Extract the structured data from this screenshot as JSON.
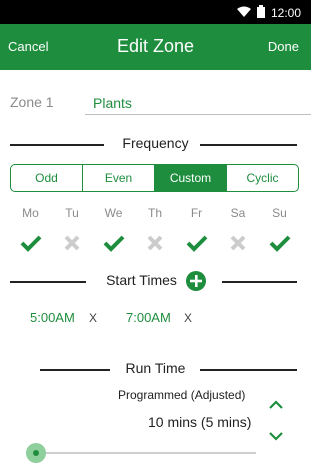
{
  "status_bar": {
    "time": "12:00"
  },
  "app_bar": {
    "cancel_label": "Cancel",
    "title": "Edit Zone",
    "done_label": "Done"
  },
  "zone": {
    "label": "Zone 1",
    "name_value": "Plants"
  },
  "frequency": {
    "header": "Frequency",
    "options": [
      "Odd",
      "Even",
      "Custom",
      "Cyclic"
    ],
    "selected": "Custom"
  },
  "days": [
    {
      "name": "Mo",
      "enabled": true
    },
    {
      "name": "Tu",
      "enabled": false
    },
    {
      "name": "We",
      "enabled": true
    },
    {
      "name": "Th",
      "enabled": false
    },
    {
      "name": "Fr",
      "enabled": true
    },
    {
      "name": "Sa",
      "enabled": false
    },
    {
      "name": "Su",
      "enabled": true
    }
  ],
  "start_times": {
    "header": "Start Times",
    "items": [
      {
        "time": "5:00AM",
        "remove": "X"
      },
      {
        "time": "7:00AM",
        "remove": "X"
      }
    ]
  },
  "run_time": {
    "header": "Run Time",
    "programmed_label": "Programmed (Adjusted)",
    "duration": "10 mins (5 mins)",
    "slider_level": 0.0
  },
  "colors": {
    "accent": "#1e8e3e",
    "inactive": "#cccccc"
  },
  "icons": [
    "wifi-icon",
    "battery-icon",
    "add-icon",
    "check-icon",
    "x-icon",
    "chevron-up-icon",
    "chevron-down-icon"
  ]
}
